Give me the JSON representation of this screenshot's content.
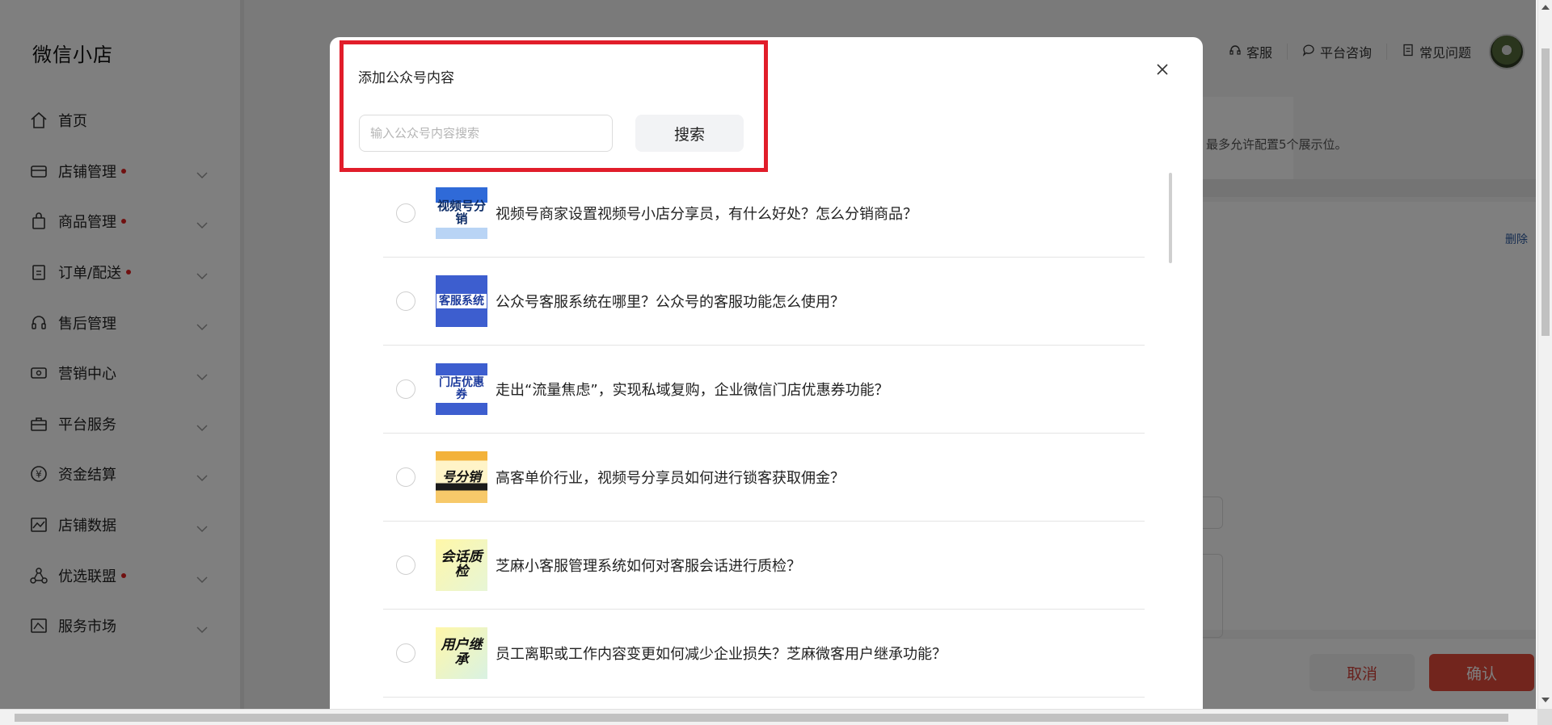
{
  "sidebar": {
    "brand": "微信小店",
    "items": [
      {
        "label": "首页",
        "icon": "home-icon",
        "dot": false,
        "chevron": false
      },
      {
        "label": "店铺管理",
        "icon": "store-icon",
        "dot": true,
        "chevron": true
      },
      {
        "label": "商品管理",
        "icon": "shopping-bag-icon",
        "dot": true,
        "chevron": true
      },
      {
        "label": "订单/配送",
        "icon": "clipboard-icon",
        "dot": true,
        "chevron": true
      },
      {
        "label": "售后管理",
        "icon": "headset-icon",
        "dot": false,
        "chevron": true
      },
      {
        "label": "营销中心",
        "icon": "ticket-icon",
        "dot": false,
        "chevron": true
      },
      {
        "label": "平台服务",
        "icon": "briefcase-icon",
        "dot": false,
        "chevron": true
      },
      {
        "label": "资金结算",
        "icon": "yuan-icon",
        "dot": false,
        "chevron": true
      },
      {
        "label": "店铺数据",
        "icon": "chart-icon",
        "dot": false,
        "chevron": true
      },
      {
        "label": "优选联盟",
        "icon": "network-icon",
        "dot": true,
        "chevron": true
      },
      {
        "label": "服务市场",
        "icon": "market-icon",
        "dot": false,
        "chevron": true
      }
    ]
  },
  "topbar": {
    "customer_service": "客服",
    "platform_consult": "平台咨询",
    "faq": "常见问题"
  },
  "background": {
    "hint": "最多允许配置5个展示位。",
    "delete_label": "删除",
    "cancel_label": "取消",
    "confirm_label": "确认"
  },
  "modal": {
    "title": "添加公众号内容",
    "search_placeholder": "输入公众号内容搜索",
    "search_value": "",
    "search_button": "搜索",
    "articles": [
      {
        "title": "视频号商家设置视频号小店分享员，有什么好处？怎么分销商品？",
        "thumb_text": "视频号分销"
      },
      {
        "title": "公众号客服系统在哪里？公众号的客服功能怎么使用？",
        "thumb_text": "客服系统"
      },
      {
        "title": "走出“流量焦虑”，实现私域复购，企业微信门店优惠券功能？",
        "thumb_text": "门店优惠券"
      },
      {
        "title": "高客单价行业，视频号分享员如何进行锁客获取佣金？",
        "thumb_text": "号分销"
      },
      {
        "title": "芝麻小客服管理系统如何对客服会话进行质检？",
        "thumb_text": "会话质检"
      },
      {
        "title": "员工离职或工作内容变更如何减少企业损失？芝麻微客用户继承功能？",
        "thumb_text": "用户继承"
      }
    ]
  },
  "colors": {
    "highlight": "#e11d2a",
    "confirm": "#e44a3a",
    "dot": "#e02020"
  }
}
